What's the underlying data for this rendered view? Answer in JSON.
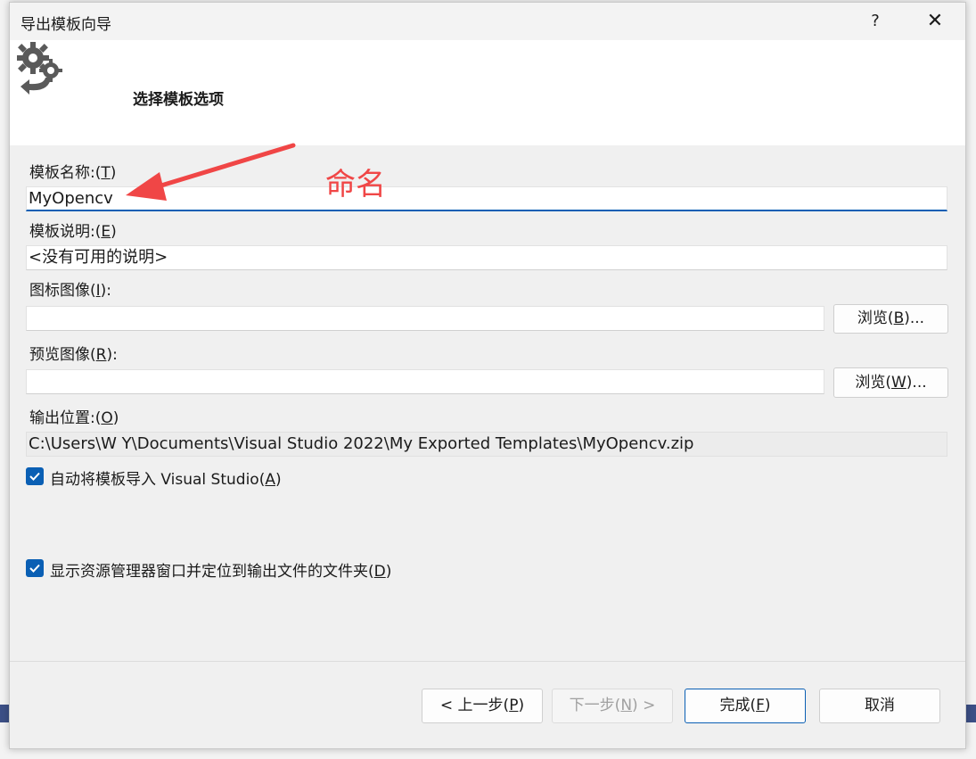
{
  "dialog": {
    "title": "导出模板向导",
    "help_label": "?",
    "close_label": "✕",
    "header_title": "选择模板选项"
  },
  "fields": {
    "template_name": {
      "label": "模板名称:",
      "accel": "T",
      "value": "MyOpencv"
    },
    "template_desc": {
      "label": "模板说明:",
      "accel": "E",
      "value": "<没有可用的说明>"
    },
    "icon_image": {
      "label": "图标图像",
      "accel": "I",
      "value": "",
      "browse_label": "浏览",
      "browse_accel": "B"
    },
    "preview_image": {
      "label": "预览图像",
      "accel": "R",
      "value": "",
      "browse_label": "浏览",
      "browse_accel": "W"
    },
    "output_location": {
      "label": "输出位置:",
      "accel": "O",
      "value": "C:\\Users\\W Y\\Documents\\Visual Studio 2022\\My Exported Templates\\MyOpencv.zip"
    }
  },
  "checkboxes": {
    "auto_import": {
      "label": "自动将模板导入 Visual Studio",
      "accel": "A",
      "checked": true
    },
    "show_explorer": {
      "label": "显示资源管理器窗口并定位到输出文件的文件夹",
      "accel": "D",
      "checked": true
    }
  },
  "buttons": {
    "back": {
      "label": "< 上一步",
      "accel": "P"
    },
    "next": {
      "label": "下一步",
      "accel": "N",
      "suffix": " >"
    },
    "finish": {
      "label": "完成",
      "accel": "F"
    },
    "cancel": {
      "label": "取消"
    }
  },
  "annotation": {
    "text": "命名",
    "color": "#f04646"
  },
  "colors": {
    "accent": "#0a5fb4",
    "header_bg": "#ffffff",
    "dialog_bg": "#f0f0f0"
  }
}
